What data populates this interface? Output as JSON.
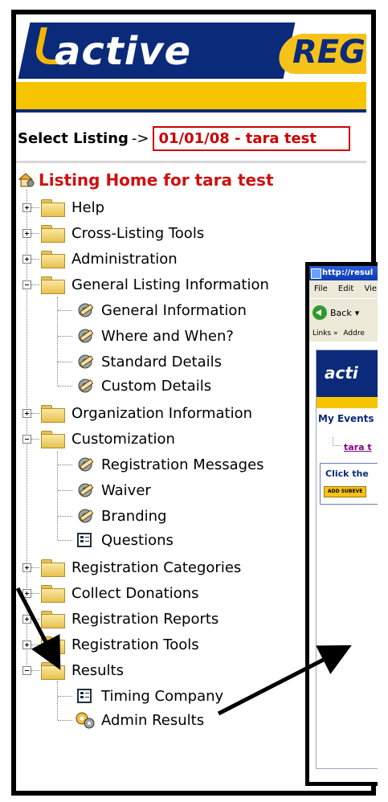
{
  "banner": {
    "brand": "active",
    "subbrand": "REGI"
  },
  "select": {
    "label": "Select Listing",
    "arrow": "->",
    "value": "01/01/08 - tara test"
  },
  "home": {
    "title": "Listing Home for tara test",
    "icon": "home-gear-icon"
  },
  "tree": [
    {
      "label": "Help",
      "expanded": false
    },
    {
      "label": "Cross-Listing Tools",
      "expanded": false
    },
    {
      "label": "Administration",
      "expanded": false
    },
    {
      "label": "General Listing Information",
      "expanded": true,
      "children": [
        "General Information",
        "Where and When?",
        "Standard Details",
        "Custom Details"
      ]
    },
    {
      "label": "Organization Information",
      "expanded": false
    },
    {
      "label": "Customization",
      "expanded": true,
      "children": [
        "Registration Messages",
        "Waiver",
        "Branding",
        "Questions"
      ]
    },
    {
      "label": "Registration Categories",
      "expanded": false
    },
    {
      "label": "Collect Donations",
      "expanded": false
    },
    {
      "label": "Registration Reports",
      "expanded": false
    },
    {
      "label": "Registration Tools",
      "expanded": false
    },
    {
      "label": "Results",
      "expanded": true,
      "children": [
        "Timing Company",
        "Admin Results"
      ]
    }
  ],
  "popup": {
    "title": "http://resul",
    "menu": [
      "File",
      "Edit",
      "Vie"
    ],
    "back": "Back",
    "links": "Links",
    "address": "Addre",
    "brand": "acti",
    "my_events": "My Events",
    "tara_link": "tara t",
    "click_text": "Click the",
    "add_button": "ADD SUBEVE"
  },
  "colors": {
    "navy": "#0b2a7a",
    "yellow": "#f6c400",
    "red": "#d01010"
  }
}
